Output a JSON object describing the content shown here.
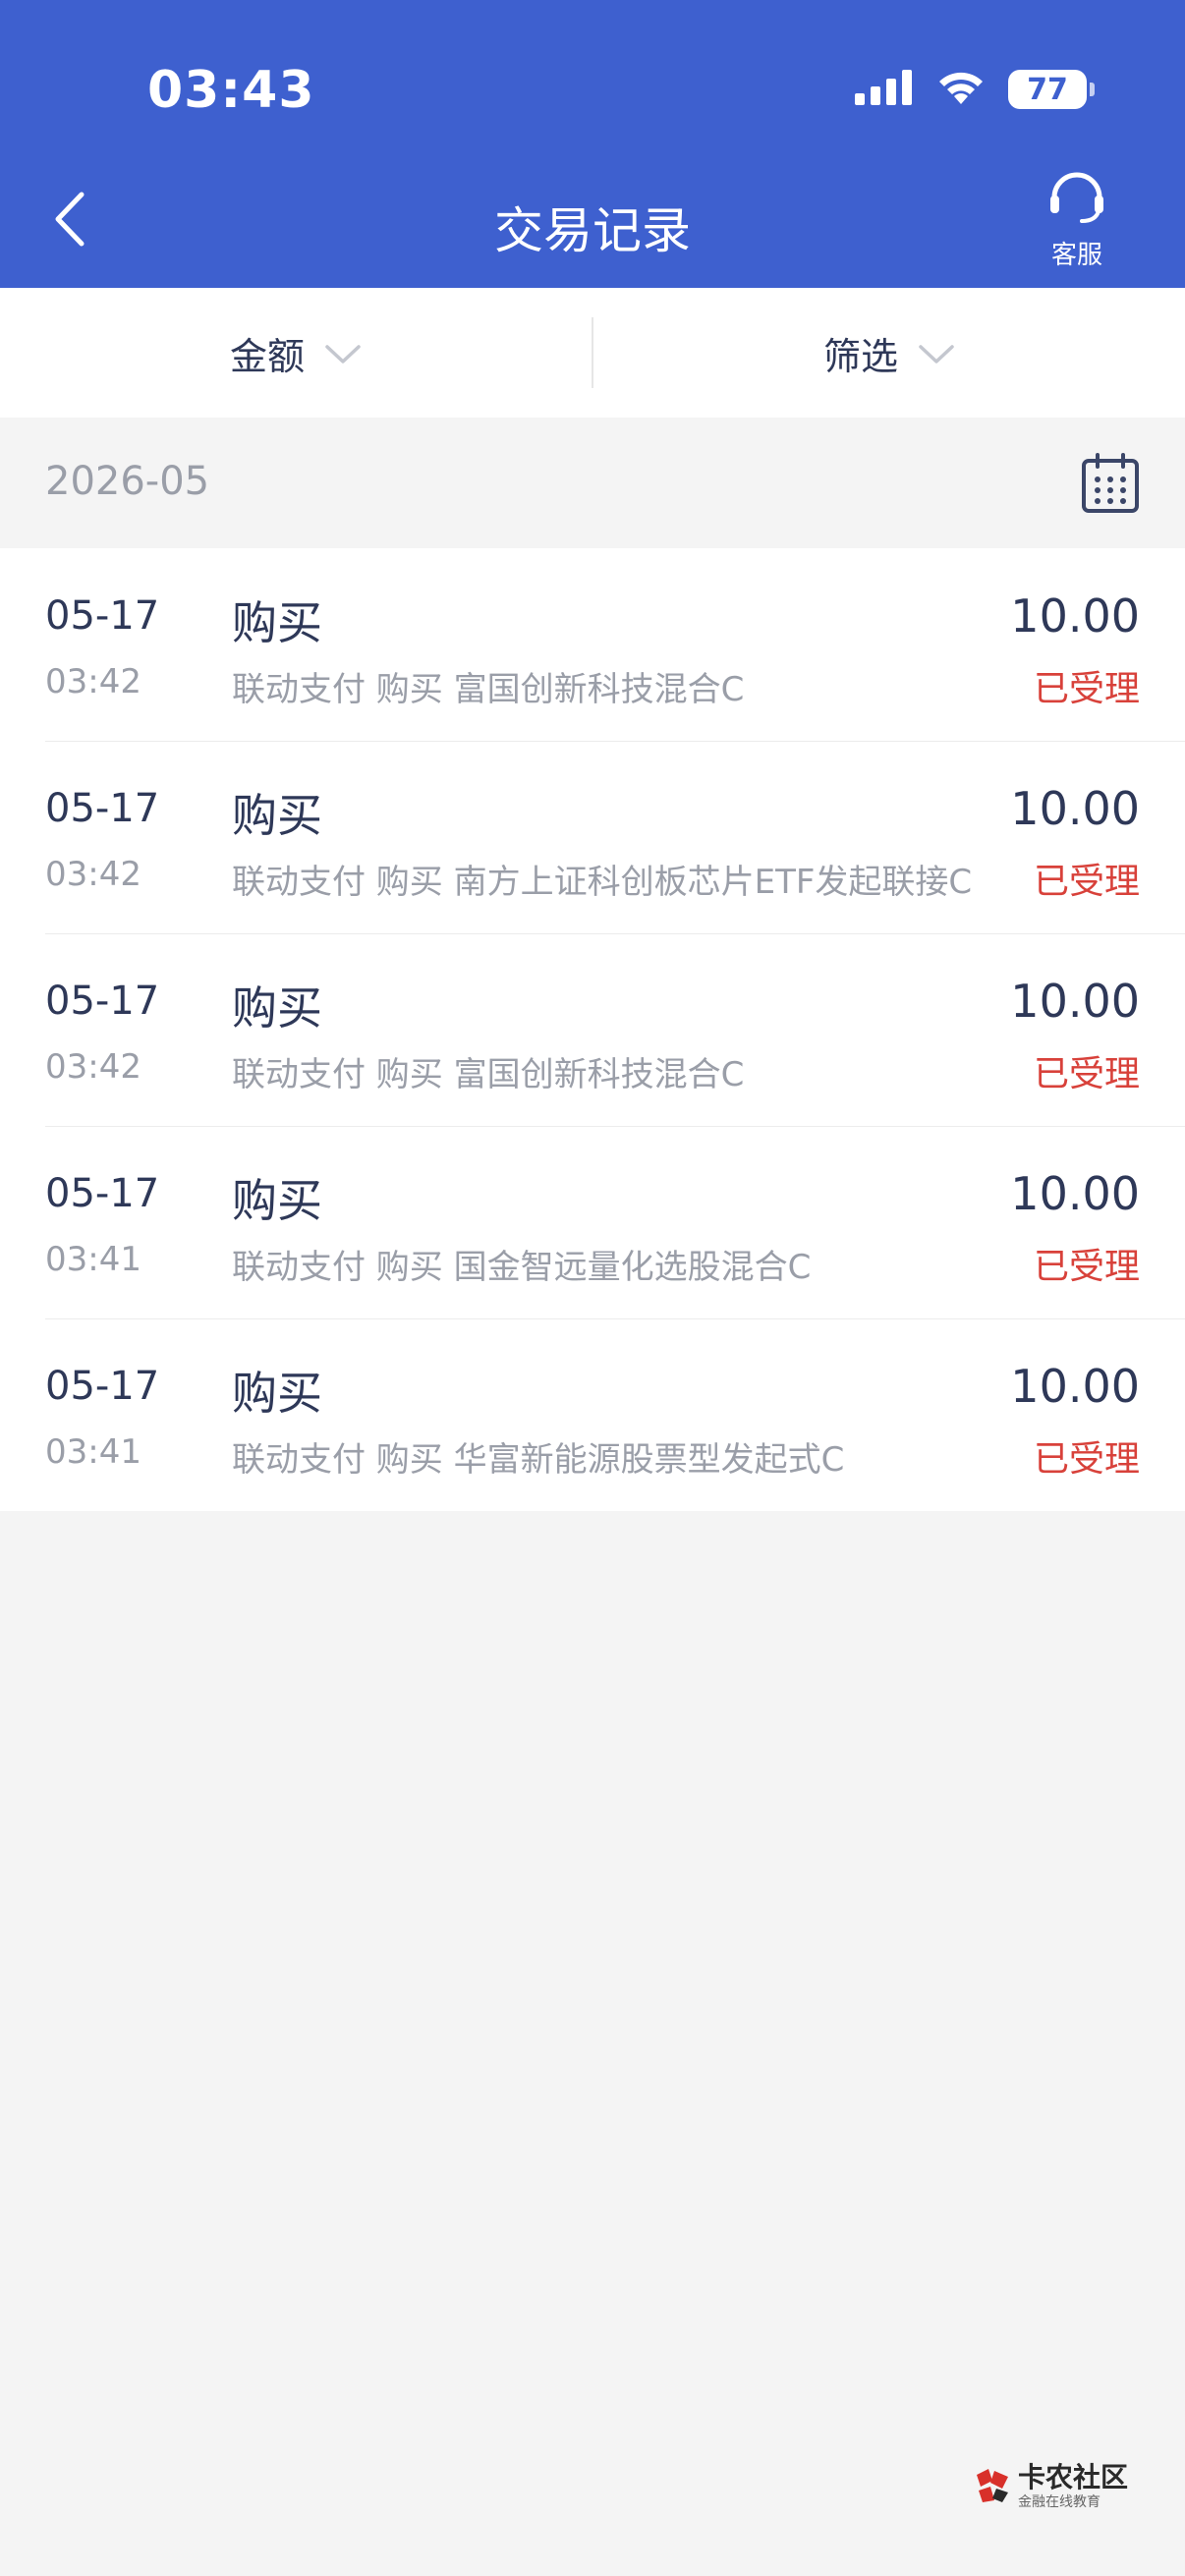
{
  "status_bar": {
    "time": "03:43",
    "battery": "77"
  },
  "header": {
    "title": "交易记录",
    "service_label": "客服"
  },
  "filters": {
    "amount_label": "金额",
    "filter_label": "筛选"
  },
  "month": {
    "label": "2026-05"
  },
  "transactions": [
    {
      "date": "05-17",
      "time": "03:42",
      "type": "购买",
      "desc": "联动支付 购买 富国创新科技混合C",
      "amount": "10.00",
      "status": "已受理"
    },
    {
      "date": "05-17",
      "time": "03:42",
      "type": "购买",
      "desc": "联动支付 购买 南方上证科创板芯片ETF发起联接C",
      "amount": "10.00",
      "status": "已受理"
    },
    {
      "date": "05-17",
      "time": "03:42",
      "type": "购买",
      "desc": "联动支付 购买 富国创新科技混合C",
      "amount": "10.00",
      "status": "已受理"
    },
    {
      "date": "05-17",
      "time": "03:41",
      "type": "购买",
      "desc": "联动支付 购买 国金智远量化选股混合C",
      "amount": "10.00",
      "status": "已受理"
    },
    {
      "date": "05-17",
      "time": "03:41",
      "type": "购买",
      "desc": "联动支付 购买 华富新能源股票型发起式C",
      "amount": "10.00",
      "status": "已受理"
    }
  ],
  "watermark": {
    "title": "卡农社区",
    "subtitle": "金融在线教育"
  },
  "colors": {
    "header_bg": "#3e60cf",
    "status_accent": "#d8413a",
    "text_primary": "#2e3858",
    "text_secondary": "#9a9ea8"
  }
}
